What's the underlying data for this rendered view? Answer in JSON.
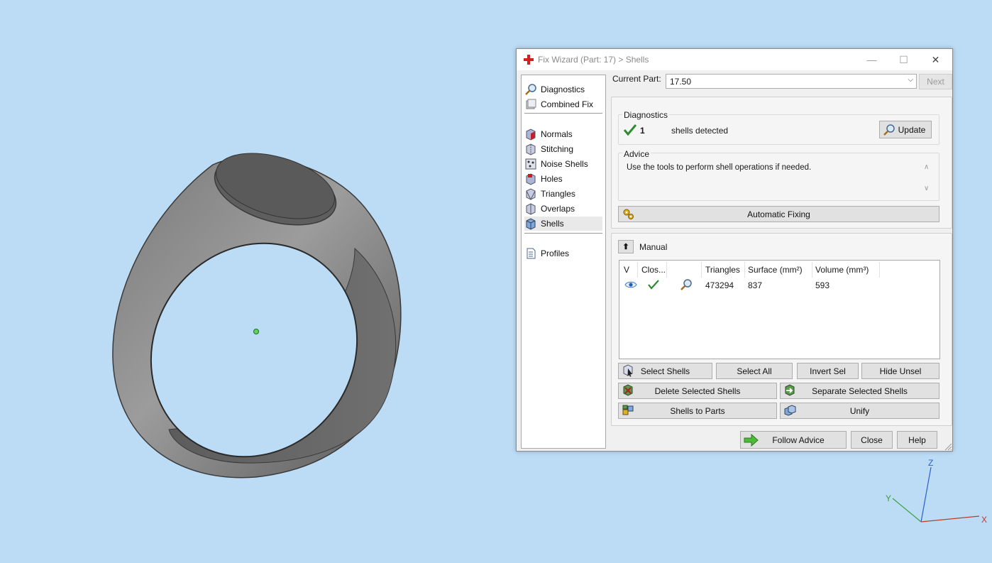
{
  "dialog": {
    "title": "Fix Wizard (Part: 17) > Shells",
    "window_buttons": {
      "minimize": "—",
      "maximize": "☐",
      "close": "✕"
    }
  },
  "nav": {
    "items_top": [
      {
        "label": "Diagnostics",
        "icon": "magnifier-icon"
      },
      {
        "label": "Combined Fix",
        "icon": "combined-fix-icon"
      }
    ],
    "items_fix": [
      {
        "label": "Normals",
        "icon": "normals-icon"
      },
      {
        "label": "Stitching",
        "icon": "stitching-icon"
      },
      {
        "label": "Noise Shells",
        "icon": "noise-shells-icon"
      },
      {
        "label": "Holes",
        "icon": "holes-icon"
      },
      {
        "label": "Triangles",
        "icon": "triangles-icon"
      },
      {
        "label": "Overlaps",
        "icon": "overlaps-icon"
      },
      {
        "label": "Shells",
        "icon": "shells-icon",
        "selected": true
      }
    ],
    "items_bottom": [
      {
        "label": "Profiles",
        "icon": "document-icon"
      }
    ]
  },
  "current_part": {
    "label": "Current Part:",
    "value": "17.50",
    "next_label": "Next"
  },
  "diagnostics": {
    "title": "Diagnostics",
    "count": "1",
    "text": "shells detected",
    "update_label": "Update"
  },
  "advice": {
    "title": "Advice",
    "text": "Use the tools to perform shell operations if needed."
  },
  "automatic_fixing_label": "Automatic Fixing",
  "manual": {
    "title": "Manual",
    "columns": [
      "V",
      "Clos...",
      "",
      "Triangles",
      "Surface (mm²)",
      "Volume (mm³)"
    ],
    "rows": [
      {
        "triangles": "473294",
        "surface": "837",
        "volume": "593"
      }
    ]
  },
  "buttons": {
    "select_shells": "Select Shells",
    "select_all": "Select All",
    "invert_sel": "Invert Sel",
    "hide_unsel": "Hide Unsel",
    "delete_selected": "Delete Selected Shells",
    "separate_selected": "Separate Selected Shells",
    "shells_to_parts": "Shells to Parts",
    "unify": "Unify"
  },
  "footer": {
    "follow_advice": "Follow Advice",
    "close": "Close",
    "help": "Help"
  },
  "axes": {
    "x": "X",
    "y": "Y",
    "z": "Z"
  },
  "colors": {
    "viewport_bg": "#bcdcf6",
    "check_green": "#2e8b2e",
    "axis_x": "#c0392b",
    "axis_y": "#3aa03a",
    "axis_z": "#2a5fd0"
  }
}
